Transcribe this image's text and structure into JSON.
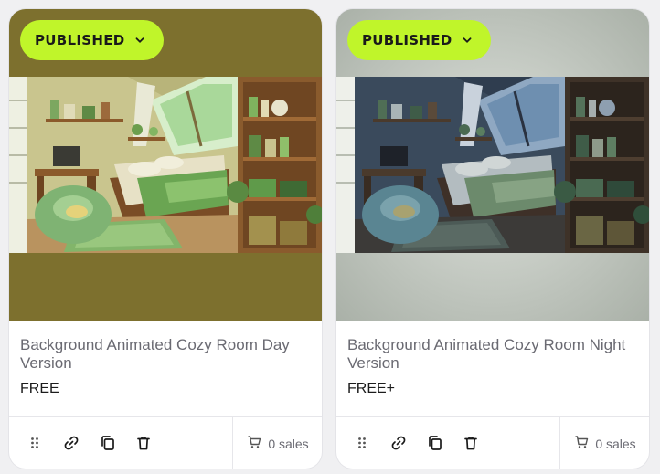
{
  "cards": [
    {
      "status": "PUBLISHED",
      "title": "Background Animated Cozy Room Day Version",
      "price": "FREE",
      "sales": "0 sales",
      "theme": "day",
      "colors": {
        "frame": "#7a6e2e",
        "badge": "#c0f52a"
      }
    },
    {
      "status": "PUBLISHED",
      "title": "Background Animated Cozy Room Night Version",
      "price": "FREE+",
      "sales": "0 sales",
      "theme": "night",
      "colors": {
        "frame": "#c2c8c0",
        "badge": "#c0f52a"
      }
    }
  ],
  "icons": {
    "status_chevron": "chevron-down-icon",
    "drag": "drag-handle-icon",
    "link": "link-icon",
    "copy": "copy-icon",
    "delete": "trash-icon",
    "sales": "cart-icon"
  }
}
